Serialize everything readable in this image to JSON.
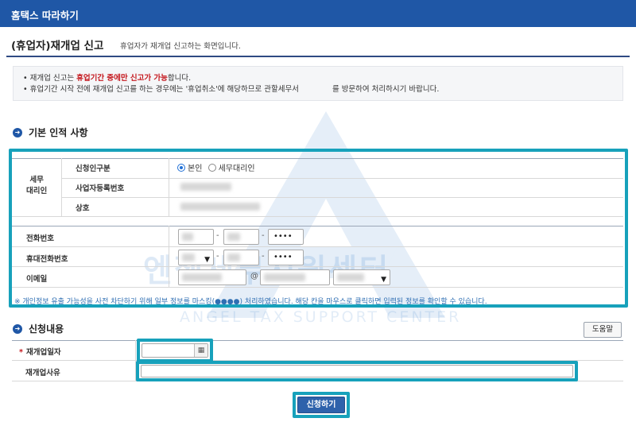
{
  "header": {
    "title": "홈택스 따라하기"
  },
  "page": {
    "title": "(휴업자)재개업 신고",
    "description": "휴업자가 재개업 신고하는 화면입니다."
  },
  "notice": {
    "line1_prefix": "재개업 신고는 ",
    "line1_highlight": "휴업기간 중에만 신고가 가능",
    "line1_suffix": "합니다.",
    "line2_prefix": "휴업기간 시작 전에 재개업 신고를 하는 경우에는 '휴업취소'에 해당하므로 관할세무서",
    "line2_suffix": "를 방문하여 처리하시기 바랍니다."
  },
  "basic_info": {
    "section_title": "기본 인적 사항",
    "group_label": "세무\n대리인",
    "applicant_type_label": "신청인구분",
    "applicant_options": [
      "본인",
      "세무대리인"
    ],
    "applicant_selected": "본인",
    "business_number_label": "사업자등록번호",
    "trade_name_label": "상호",
    "phone_label": "전화번호",
    "phone_last": "••••",
    "mobile_label": "휴대전화번호",
    "mobile_last": "••••",
    "email_label": "이메일",
    "email_at": "@",
    "masking_notice": "※ 개인정보 유출 가능성을 사전 차단하기 위해 일부 정보를 마스킹(●●●●) 처리하였습니다. 해당 칸을 마우스로 클릭하면 입력된 정보를 확인할 수 있습니다."
  },
  "request": {
    "section_title": "신청내용",
    "help_button": "도움말",
    "reopen_date_label": "재개업일자",
    "reopen_date_value": "",
    "reopen_reason_label": "재개업사유",
    "reopen_reason_value": "",
    "submit_button": "신청하기"
  },
  "watermark": {
    "text": "엔젤세무지원센터",
    "subtext": "ANGEL TAX SUPPORT CENTER"
  },
  "colors": {
    "header_bg": "#1f57a6",
    "highlight": "#17a1bb",
    "notice_red": "#c4161c",
    "submit_bg": "#2e62ab"
  },
  "icons": {
    "section": "arrow-circle-icon",
    "calendar": "calendar-icon",
    "select": "chevron-down-icon"
  }
}
